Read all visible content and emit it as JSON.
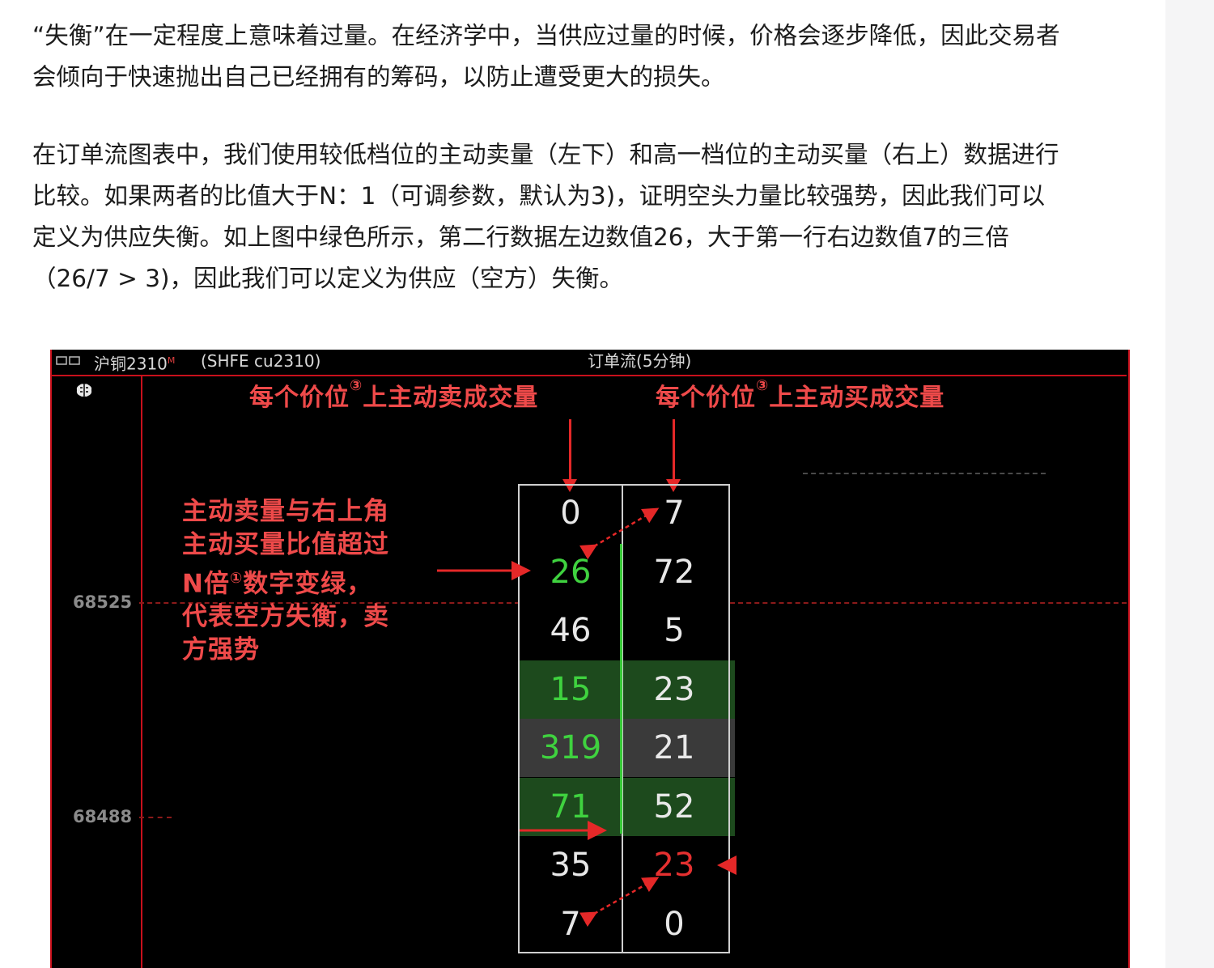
{
  "article": {
    "para1": [
      "“失衡”在一定程度上意味着过量。在经济学中，当供应过量的时候，价格会逐步降低，因此交易者",
      "会倾向于快速抛出自己已经拥有的筹码，以防止遭受更大的损失。"
    ],
    "para2": [
      "在订单流图表中，我们使用较低档位的主动卖量（左下）和高一档位的主动买量（右上）数据进行",
      "比较。如果两者的比值大于N：1（可调参数，默认为3)，证明空头力量比较强势，因此我们可以",
      "定义为供应失衡。如上图中绿色所示，第二行数据左边数值26，大于第一行右边数值7的三倍",
      "（26/7 > 3)，因此我们可以定义为供应（空方）失衡。"
    ]
  },
  "screenshot": {
    "header_left": "沪铜2310",
    "header_left_sup": "M",
    "header_code": "(SHFE  cu2310)",
    "header_center": "订单流(5分钟)",
    "price_labels": [
      "68525",
      "68488"
    ],
    "title_sell": {
      "pre": "每个价位",
      "circ": "③",
      "post": "上主动卖成交量"
    },
    "title_buy": {
      "pre": "每个价位",
      "circ": "③",
      "post": "上主动买成交量"
    },
    "annotation": {
      "line1": "主动卖量与右上角",
      "line2": "主动买量比值超过",
      "line3_pre": "N倍",
      "line3_circ": "①",
      "line3_post": "数字变绿，",
      "line4": "代表空方失衡，卖",
      "line5": "方强势"
    },
    "rows": [
      {
        "sell": "0",
        "buy": "7",
        "sell_color": "white",
        "buy_color": "white",
        "bg": ""
      },
      {
        "sell": "26",
        "buy": "72",
        "sell_color": "green",
        "buy_color": "white",
        "bg": ""
      },
      {
        "sell": "46",
        "buy": "5",
        "sell_color": "white",
        "buy_color": "white",
        "bg": ""
      },
      {
        "sell": "15",
        "buy": "23",
        "sell_color": "green",
        "buy_color": "white",
        "bg": "#1d4a1d"
      },
      {
        "sell": "319",
        "buy": "21",
        "sell_color": "green",
        "buy_color": "white",
        "bg": "#3a3a3a"
      },
      {
        "sell": "71",
        "buy": "52",
        "sell_color": "green",
        "buy_color": "white",
        "bg": "#1d4a1d"
      },
      {
        "sell": "35",
        "buy": "23",
        "sell_color": "white",
        "buy_color": "red",
        "bg": ""
      },
      {
        "sell": "7",
        "buy": "0",
        "sell_color": "white",
        "buy_color": "white",
        "bg": ""
      }
    ],
    "colors": {
      "accent_red": "#e52828",
      "imbalance_green": "#3fd23f",
      "chart_bg": "#000000"
    },
    "icons": [
      "brain-icon",
      "window-icon"
    ]
  }
}
